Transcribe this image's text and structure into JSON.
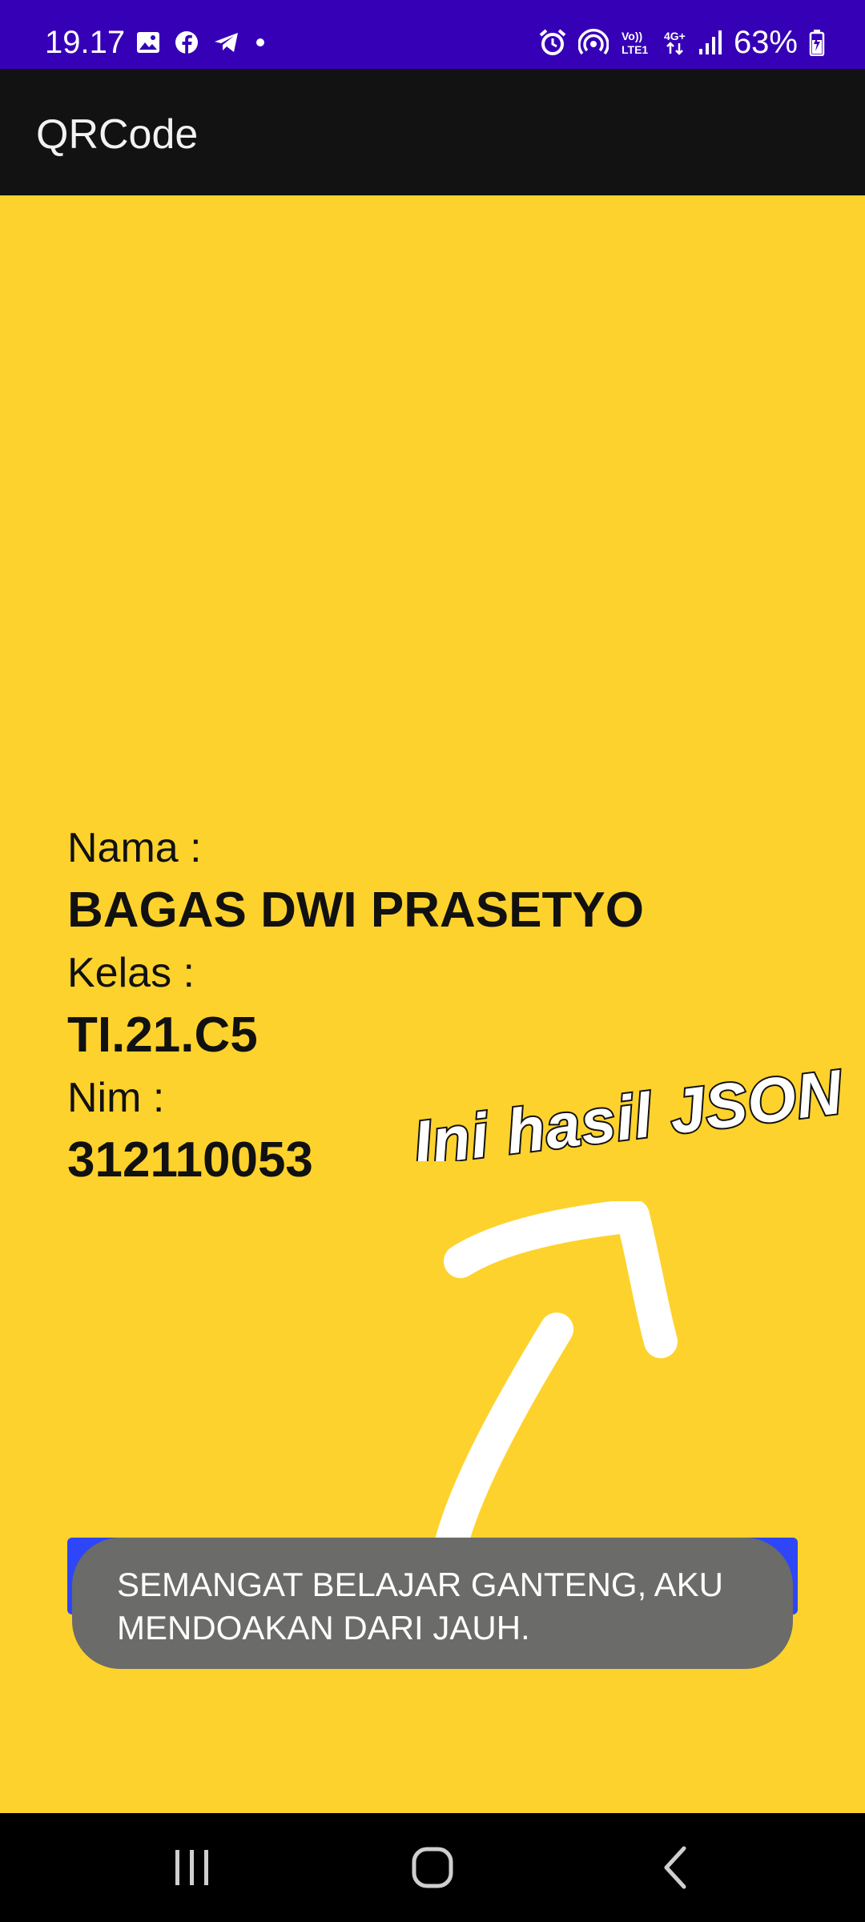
{
  "status_bar": {
    "time": "19.17",
    "battery": "63%",
    "left_icons": [
      "image-icon",
      "facebook-icon",
      "telegram-icon",
      "dot-icon"
    ],
    "right_icons": [
      "alarm-icon",
      "hotspot-icon",
      "volte-icon",
      "4g-icon",
      "signal-icon",
      "battery-charging-icon"
    ],
    "background_color": "#3600B6"
  },
  "app_bar": {
    "title": "QRCode",
    "background_color": "#121212"
  },
  "content": {
    "background_color": "#FED22C",
    "nama_label": "Nama :",
    "nama_value": "BAGAS DWI PRASETYO",
    "kelas_label": "Kelas :",
    "kelas_value": "TI.21.C5",
    "nim_label": "Nim :",
    "nim_value": "312110053"
  },
  "annotation": {
    "text": "Ini hasil JSON"
  },
  "button": {
    "color": "#2E46F7"
  },
  "toast": {
    "text": "SEMANGAT BELAJAR GANTENG, AKU MENDOAKAN DARI JAUH."
  },
  "nav_bar": {
    "buttons": [
      "recent-apps-icon",
      "home-icon",
      "back-icon"
    ]
  }
}
